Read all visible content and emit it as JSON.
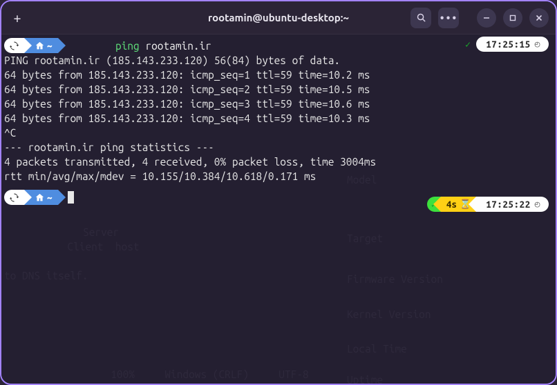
{
  "titlebar": {
    "title": "rootamin@ubuntu-desktop:~",
    "newtab_label": "+"
  },
  "prompt1": {
    "loop_icon": "↻",
    "home_icon": "🏠",
    "tilde": "~",
    "command_name": "ping",
    "command_arg": "rootamin.ir",
    "status_check": "✓",
    "time": "17:25:15"
  },
  "output": {
    "l1": "PING rootamin.ir (185.143.233.120) 56(84) bytes of data.",
    "l2": "64 bytes from 185.143.233.120: icmp_seq=1 ttl=59 time=10.2 ms",
    "l3": "64 bytes from 185.143.233.120: icmp_seq=2 ttl=59 time=10.5 ms",
    "l4": "64 bytes from 185.143.233.120: icmp_seq=3 ttl=59 time=10.6 ms",
    "l5": "64 bytes from 185.143.233.120: icmp_seq=4 ttl=59 time=10.3 ms",
    "l6": "^C",
    "l7": "--- rootamin.ir ping statistics ---",
    "l8": "4 packets transmitted, 4 received, 0% packet loss, time 3004ms",
    "l9": "rtt min/avg/max/mdev = 10.155/10.384/10.618/0.171 ms"
  },
  "prompt2": {
    "loop_icon": "↻",
    "home_icon": "🏠",
    "tilde": "~",
    "status_check": "✓",
    "duration": "4s",
    "hourglass": "⌛",
    "time": "17:25:22"
  },
  "ghost": {
    "g1": "to DNS itself.",
    "g2": "   Server",
    "g3": "     Client  host",
    "g4": "                  100%     Windows (CRLF)     UTF-8",
    "g5": "Model",
    "g6": "Target",
    "g7": "Firmware Version",
    "g8": "Kernel Version",
    "g9": "Local Time",
    "g10": "Uptime"
  }
}
